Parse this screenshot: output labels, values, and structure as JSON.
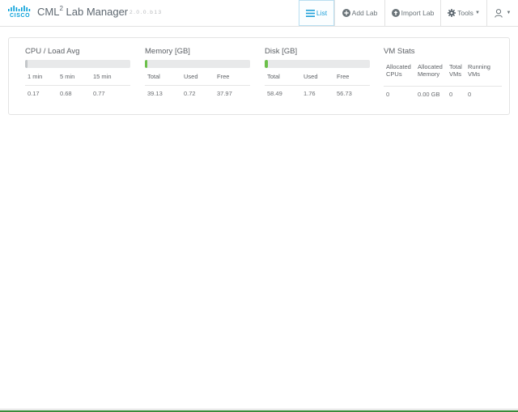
{
  "header": {
    "brand": "CISCO",
    "title_main": "CML",
    "title_sup": "2",
    "title_rest": " Lab Manager",
    "version": "2.0.0.b13",
    "nav": {
      "list": "List",
      "add_lab": "Add Lab",
      "import_lab": "Import Lab",
      "tools": "Tools"
    }
  },
  "stats": {
    "cpu": {
      "title": "CPU / Load Avg",
      "usage_fraction": 0.01,
      "headers": [
        "1 min",
        "5 min",
        "15 min"
      ],
      "values": [
        "0.17",
        "0.68",
        "0.77"
      ]
    },
    "memory": {
      "title": "Memory [GB]",
      "used_fraction": 0.018,
      "headers": [
        "Total",
        "Used",
        "Free"
      ],
      "values": [
        "39.13",
        "0.72",
        "37.97"
      ]
    },
    "disk": {
      "title": "Disk [GB]",
      "used_fraction": 0.03,
      "headers": [
        "Total",
        "Used",
        "Free"
      ],
      "values": [
        "58.49",
        "1.76",
        "56.73"
      ]
    },
    "vm": {
      "title": "VM Stats",
      "headers": [
        [
          "Allocated",
          "CPUs"
        ],
        [
          "Allocated",
          "Memory"
        ],
        [
          "Total",
          "VMs"
        ],
        [
          "Running",
          "VMs"
        ]
      ],
      "values": [
        "0",
        "0.00 GB",
        "0",
        "0"
      ]
    }
  },
  "colors": {
    "accent": "#1fa0d9",
    "usage_bar": "#6cc04a",
    "cisco_blue": "#049fd9"
  }
}
